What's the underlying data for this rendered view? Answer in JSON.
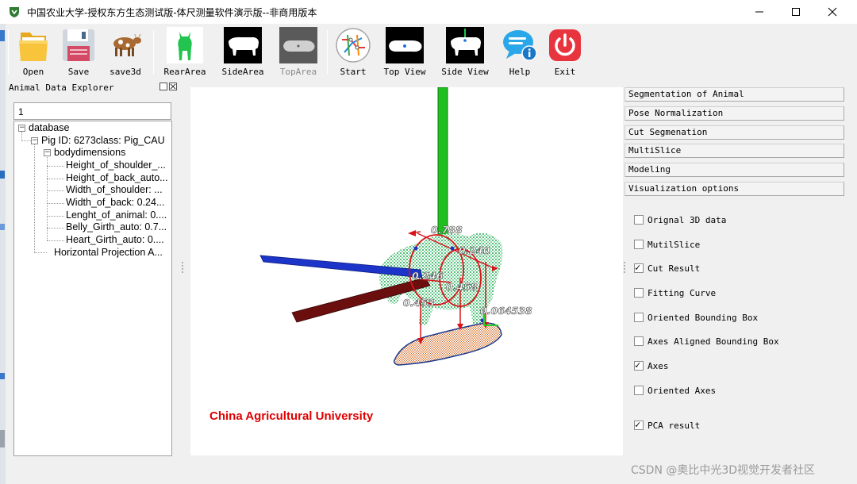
{
  "window": {
    "title": "中国农业大学-授权东方生态测试版-体尺测量软件演示版--非商用版本"
  },
  "toolbar": {
    "buttons": [
      {
        "label": "Open",
        "icon": "folder-icon"
      },
      {
        "label": "Save",
        "icon": "floppy-disk-icon"
      },
      {
        "label": "save3d",
        "icon": "cow-icon"
      },
      {
        "label": "RearArea",
        "icon": "green-animal-icon"
      },
      {
        "label": "SideArea",
        "icon": "pig-side-silhouette-icon"
      },
      {
        "label": "TopArea",
        "icon": "pig-top-silhouette-icon",
        "disabled": true
      },
      {
        "label": "Start",
        "icon": "metro-map-icon"
      },
      {
        "label": "Top View",
        "icon": "top-view-icon"
      },
      {
        "label": "Side View",
        "icon": "side-view-icon"
      },
      {
        "label": "Help",
        "icon": "info-bubble-icon"
      },
      {
        "label": "Exit",
        "icon": "power-icon"
      }
    ]
  },
  "explorer": {
    "title": "Animal Data Explorer",
    "search_value": "1",
    "tree": [
      {
        "label": "database",
        "level": 0,
        "expander": "−"
      },
      {
        "label": "Pig  ID: 6273class: Pig_CAU",
        "level": 1,
        "expander": "−"
      },
      {
        "label": "bodydimensions",
        "level": 2,
        "expander": "−"
      },
      {
        "label": "Height_of_shoulder_...",
        "level": 3
      },
      {
        "label": "Height_of_back_auto...",
        "level": 3
      },
      {
        "label": "Width_of_shoulder: ...",
        "level": 3
      },
      {
        "label": "Width_of_back: 0.24...",
        "level": 3
      },
      {
        "label": "Lenght_of_animal: 0....",
        "level": 3
      },
      {
        "label": "Belly_Girth_auto: 0.7...",
        "level": 3
      },
      {
        "label": "Heart_Girth_auto: 0....",
        "level": 3
      },
      {
        "label": "Horizontal Projection A...",
        "level": 2
      }
    ]
  },
  "viewport": {
    "watermark": "China Agricultural University",
    "measure_labels": [
      "0.788",
      "0.240",
      "0.246",
      "0.458",
      "0.453",
      "0.064538"
    ]
  },
  "right_panel": {
    "sections": [
      "Segmentation of Animal",
      "Pose Normalization",
      "Cut Segmenation",
      "MultiSlice",
      "Modeling",
      "Visualization options"
    ],
    "options": [
      {
        "label": "Orignal 3D data",
        "checked": false
      },
      {
        "label": "MutilSlice",
        "checked": false
      },
      {
        "label": "Cut Result",
        "checked": true
      },
      {
        "label": "Fitting Curve",
        "checked": false
      },
      {
        "label": "Oriented Bounding Box",
        "checked": false
      },
      {
        "label": "Axes Aligned Bounding Box",
        "checked": false
      },
      {
        "label": "Axes",
        "checked": true
      },
      {
        "label": "Oriented Axes",
        "checked": false
      },
      {
        "label": "PCA result",
        "checked": true
      }
    ]
  },
  "footer": {
    "watermark": "CSDN @奥比中光3D视觉开发者社区"
  }
}
